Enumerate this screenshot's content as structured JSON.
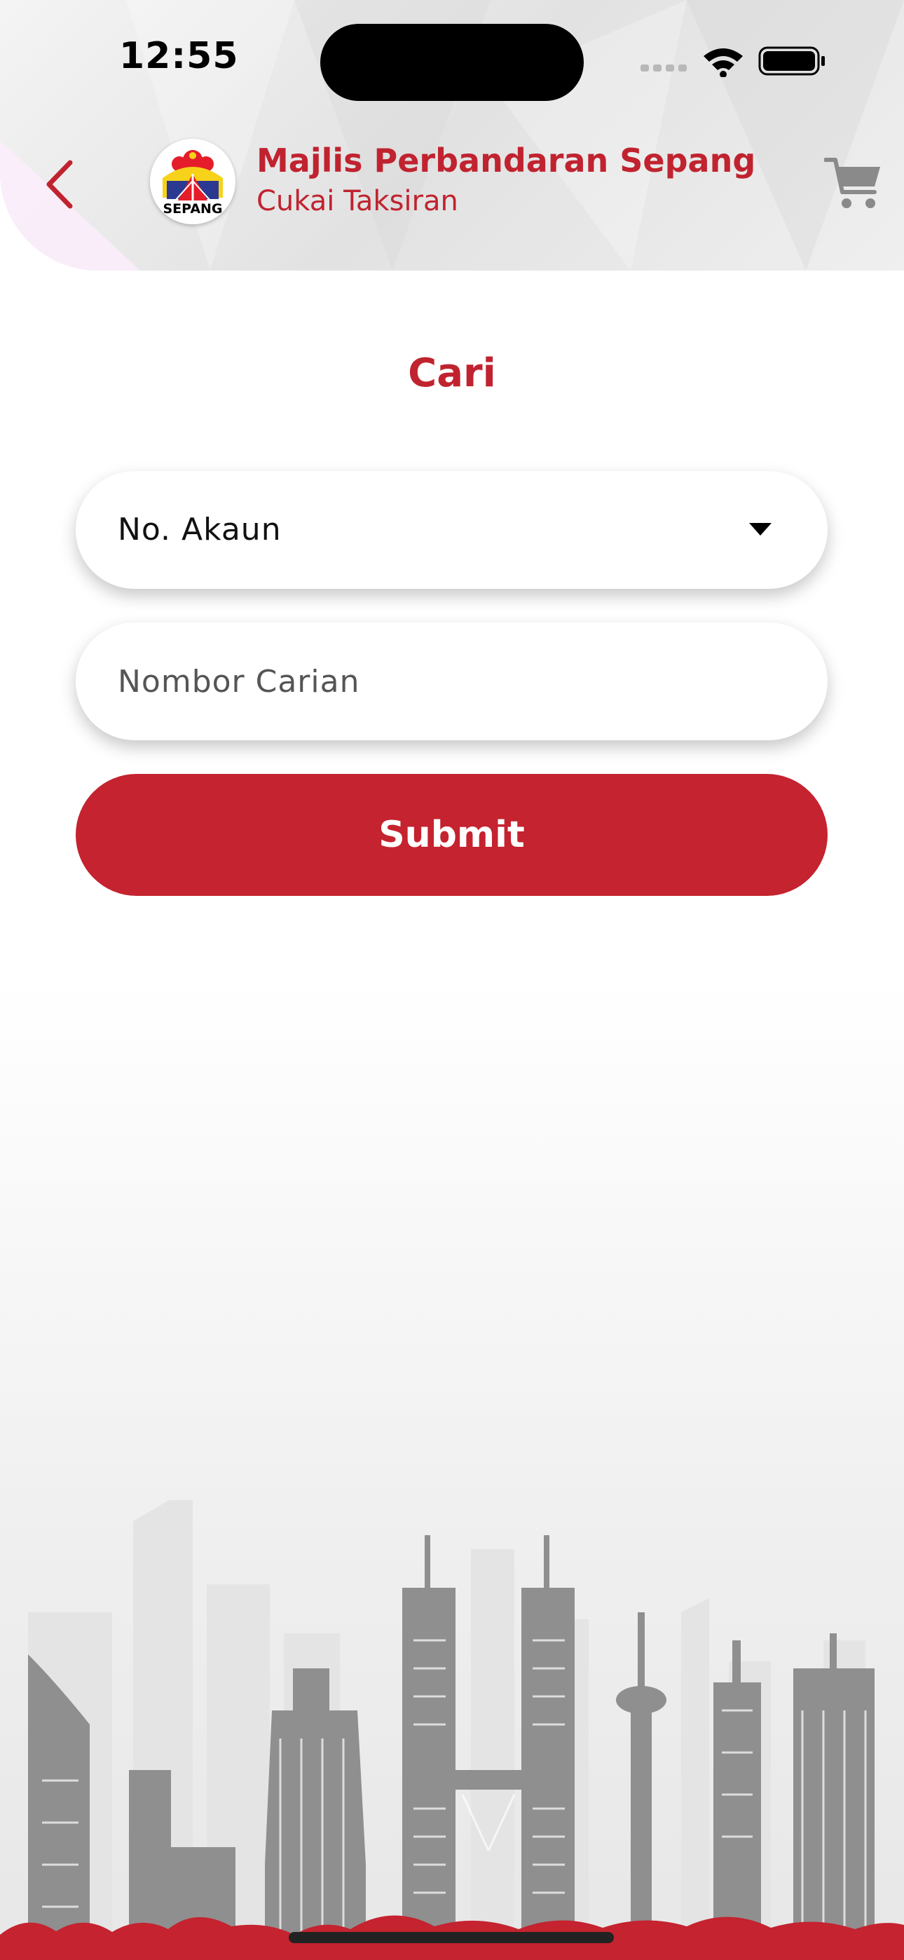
{
  "status_bar": {
    "time": "12:55",
    "icons": [
      "signal-icon",
      "wifi-icon",
      "battery-icon"
    ]
  },
  "header": {
    "back_icon": "chevron-left-icon",
    "org_name": "Majlis Perbandaran Sepang",
    "service_name": "Cukai Taksiran",
    "logo_text": "SEPANG",
    "cart_icon": "cart-icon"
  },
  "form": {
    "title": "Cari",
    "search_type_selected": "No. Akaun",
    "search_input_placeholder": "Nombor Carian",
    "search_input_value": "",
    "submit_label": "Submit"
  },
  "colors": {
    "brand_red": "#c4232f",
    "header_gray": "#e6e6e6",
    "skyline_gray": "#8a8a8a"
  }
}
